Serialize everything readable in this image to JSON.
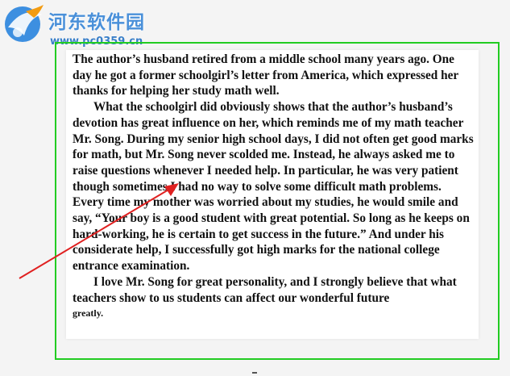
{
  "brand": {
    "title": "河东软件园",
    "url": "www.pc0359.cn"
  },
  "document": {
    "paragraphs": [
      "The author’s husband retired from a middle school many years ago. One day he got a former schoolgirl’s letter from America, which expressed her thanks for helping her study math well.",
      "What the schoolgirl did obviously shows that the author’s husband’s devotion has great influence on her, which reminds me of my math teacher Mr. Song. During my senior high school days, I did not often get good marks for math, but Mr. Song never scolded me. Instead, he always asked me to raise questions whenever I needed help. In particular, he was very patient though sometimes I had no way to solve some difficult math problems. Every time my mother was worried about my studies, he would smile and say, “Your boy is a good student with great potential. So long as he keeps on hard-working, he is certain to get success in the future.” And under his considerate help, I successfully got high marks for the national college entrance examination.",
      "I love Mr. Song for great personality, and I strongly believe that what teachers show to us students can affect our wonderful future"
    ],
    "last_word": "greatly."
  },
  "colors": {
    "frame": "#22cc22",
    "arrow": "#e02020",
    "brand": "#4a90d9"
  }
}
